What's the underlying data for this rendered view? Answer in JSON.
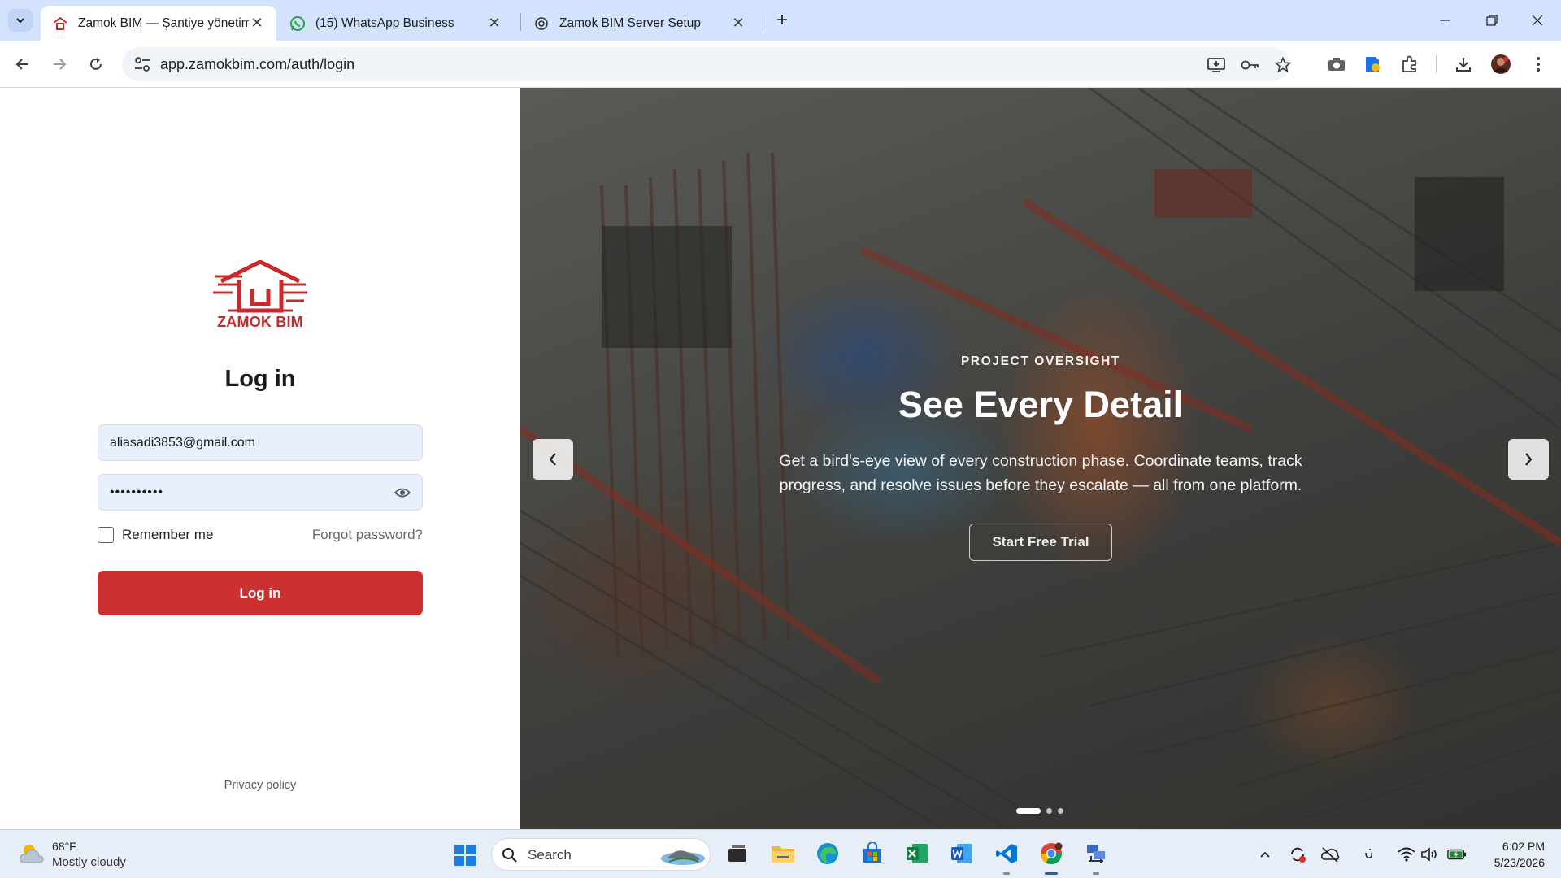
{
  "browser": {
    "tabs": [
      {
        "title": "Zamok BIM — Şantiye yönetimi",
        "active": true,
        "favicon": "zamok-logo-icon"
      },
      {
        "title": "(15) WhatsApp Business",
        "active": false,
        "favicon": "whatsapp-icon"
      },
      {
        "title": "Zamok BIM Server Setup",
        "active": false,
        "favicon": "openai-icon"
      }
    ],
    "url": "app.zamokbim.com/auth/login",
    "accent": "#d3e3fd"
  },
  "login": {
    "logo_text": "ZAMOK BIM",
    "heading": "Log in",
    "email_value": "aliasadi3853@gmail.com",
    "password_value": "••••••••••",
    "remember_label": "Remember me",
    "forgot_label": "Forgot password?",
    "submit_label": "Log in",
    "privacy_label": "Privacy policy",
    "brand_color": "#cc2f2f"
  },
  "hero": {
    "eyebrow": "PROJECT OVERSIGHT",
    "title": "See Every Detail",
    "description": "Get a bird's-eye view of every construction phase. Coordinate teams, track progress, and resolve issues before they escalate — all from one platform.",
    "cta_label": "Start Free Trial",
    "slides_total": 3,
    "slide_active": 1
  },
  "taskbar": {
    "weather_temp": "68°F",
    "weather_desc": "Mostly cloudy",
    "search_label": "Search",
    "apps": [
      "file-explorer-icon",
      "task-view-icon",
      "edge-icon",
      "store-icon",
      "excel-icon",
      "word-icon",
      "vscode-icon",
      "chrome-icon",
      "network-app-icon"
    ],
    "clock_time": "6:02 PM",
    "clock_date": "5/23/2026"
  }
}
